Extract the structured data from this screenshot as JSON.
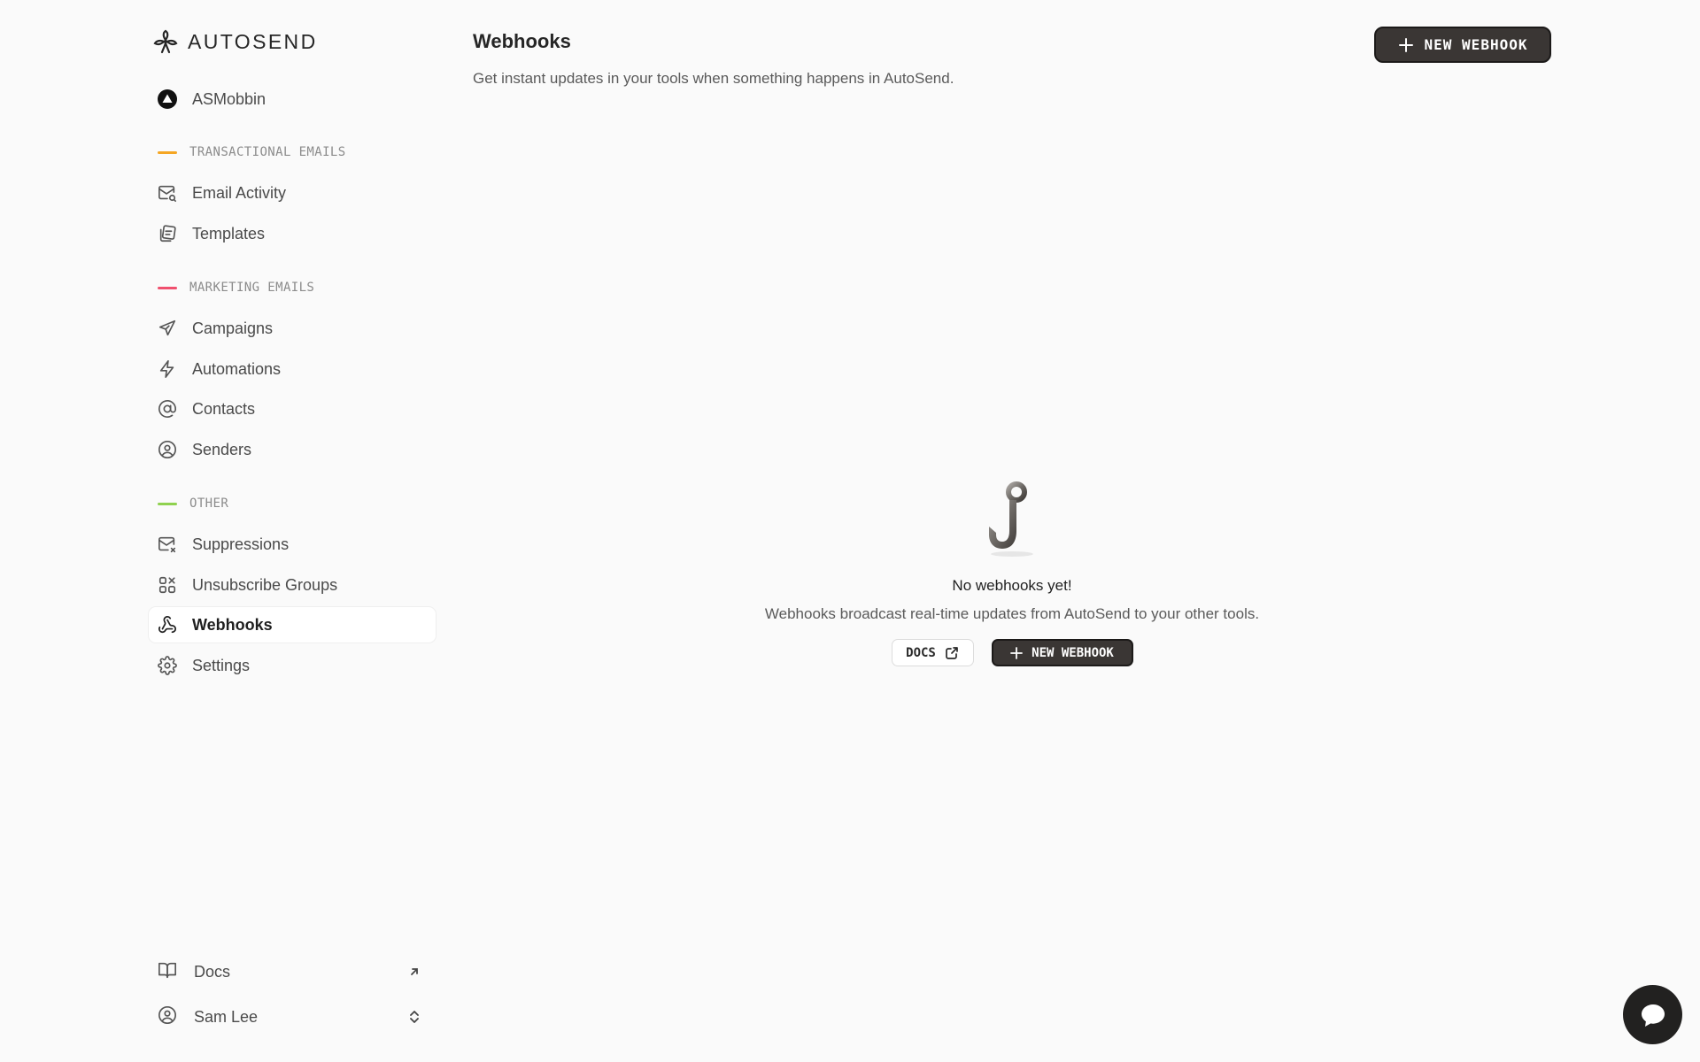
{
  "brand": {
    "name": "AUTOSEND"
  },
  "workspace": {
    "name": "ASMobbin"
  },
  "sections": {
    "transactional": {
      "label": "TRANSACTIONAL EMAILS",
      "color": "#f5a623"
    },
    "marketing": {
      "label": "MARKETING EMAILS",
      "color": "#f0506e"
    },
    "other": {
      "label": "OTHER",
      "color": "#8fd14f"
    }
  },
  "nav": {
    "email_activity": "Email Activity",
    "templates": "Templates",
    "campaigns": "Campaigns",
    "automations": "Automations",
    "contacts": "Contacts",
    "senders": "Senders",
    "suppressions": "Suppressions",
    "unsubscribe_groups": "Unsubscribe Groups",
    "webhooks": "Webhooks",
    "settings": "Settings"
  },
  "active_nav": "Webhooks",
  "footer": {
    "docs": "Docs",
    "user": "Sam Lee"
  },
  "header": {
    "title": "Webhooks",
    "subtitle": "Get instant updates in your tools when something happens in AutoSend.",
    "new_button": "NEW WEBHOOK"
  },
  "empty_state": {
    "title": "No webhooks yet!",
    "description": "Webhooks broadcast real-time updates from AutoSend to your other tools.",
    "docs_button": "DOCS",
    "new_button": "NEW WEBHOOK"
  },
  "icons": {
    "logo": "flower-logo-icon",
    "workspace": "triangle-avatar-icon",
    "email_activity": "mail-search-icon",
    "templates": "templates-icon",
    "campaigns": "send-icon",
    "automations": "bolt-icon",
    "contacts": "at-sign-icon",
    "senders": "user-circle-icon",
    "suppressions": "mail-x-icon",
    "unsubscribe_groups": "groups-x-icon",
    "webhooks": "webhook-icon",
    "settings": "gear-icon",
    "docs": "book-icon",
    "user": "user-circle-icon",
    "chat": "chat-bubble-icon"
  }
}
